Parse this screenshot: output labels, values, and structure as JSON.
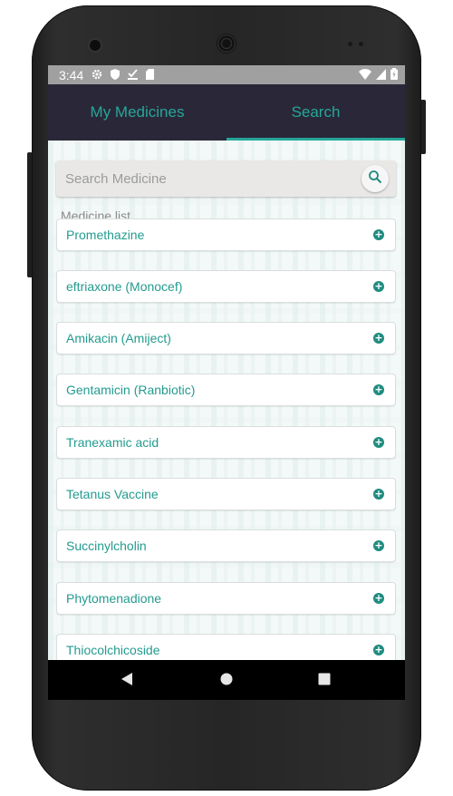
{
  "status_bar": {
    "time": "3:44",
    "icons": [
      "gear-icon",
      "shield-icon",
      "download-done-icon",
      "sd-card-icon"
    ],
    "right_icons": [
      "wifi-icon",
      "signal-icon",
      "battery-icon"
    ]
  },
  "tabs": [
    {
      "label": "My Medicines",
      "selected": false
    },
    {
      "label": "Search",
      "selected": true
    }
  ],
  "search": {
    "placeholder": "Search Medicine",
    "value": ""
  },
  "list_title": "Medicine list",
  "medicines": [
    {
      "name": "Promethazine"
    },
    {
      "name": "eftriaxone (Monocef)"
    },
    {
      "name": "Amikacin (Amiject)"
    },
    {
      "name": "Gentamicin (Ranbiotic)"
    },
    {
      "name": "Tranexamic acid"
    },
    {
      "name": "Tetanus Vaccine"
    },
    {
      "name": "Succinylcholin"
    },
    {
      "name": "Phytomenadione"
    },
    {
      "name": "Thiocolchicoside"
    }
  ],
  "colors": {
    "accent": "#26a69a",
    "tab_bar": "#2a2838",
    "status_bar": "#a0a0a0"
  },
  "navigation": [
    "back-icon",
    "home-icon",
    "recents-icon"
  ]
}
